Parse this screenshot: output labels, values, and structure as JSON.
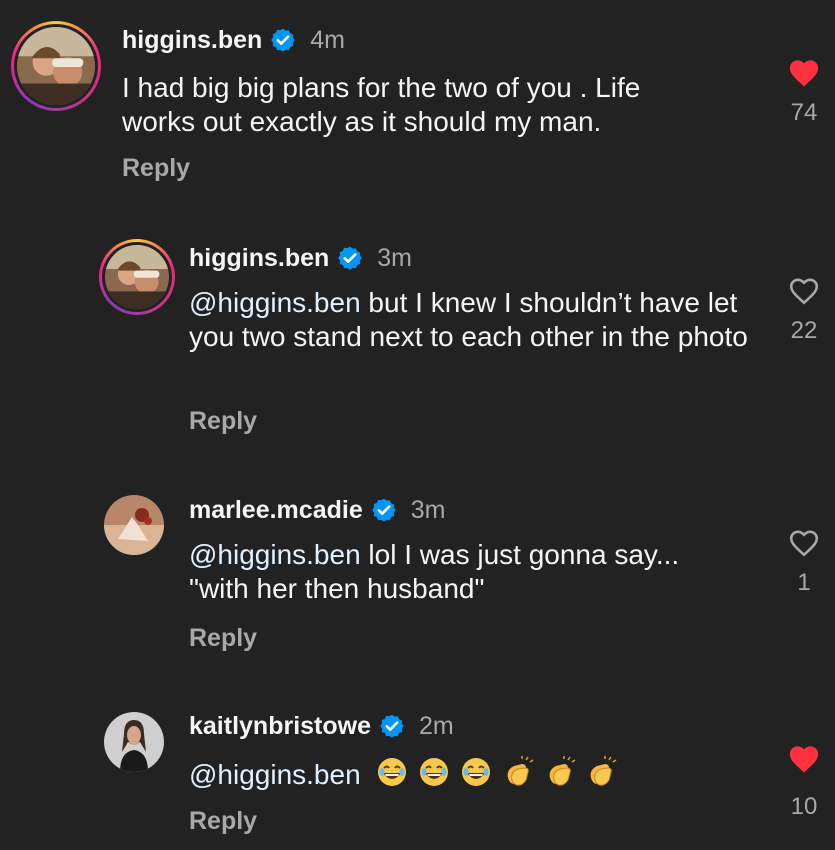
{
  "comments": [
    {
      "username": "higgins.ben",
      "time": "4m",
      "text": "I had big big plans for the two of you . Life works out exactly as it should my man.",
      "reply_label": "Reply",
      "likes": "74",
      "liked": true
    },
    {
      "username": "higgins.ben",
      "time": "3m",
      "mention": "@higgins.ben",
      "text": " but I knew I shouldn’t have let you two stand next to each other in the photo",
      "reply_label": "Reply",
      "likes": "22",
      "liked": false
    },
    {
      "username": "marlee.mcadie",
      "time": "3m",
      "mention": "@higgins.ben",
      "text": " lol I was just gonna say... \"with her then husband\"",
      "reply_label": "Reply",
      "likes": "1",
      "liked": false
    },
    {
      "username": "kaitlynbristowe",
      "time": "2m",
      "mention": "@higgins.ben",
      "text": "",
      "emojis": [
        "laughing-emoji",
        "laughing-emoji",
        "laughing-emoji",
        "clapping-emoji",
        "clapping-emoji",
        "clapping-emoji"
      ],
      "reply_label": "Reply",
      "likes": "10",
      "liked": true
    }
  ],
  "colors": {
    "background": "#222223",
    "text": "#f5f5f5",
    "secondary": "#a8a8a8",
    "mention": "#e0f1ff",
    "verified": "#0095f6",
    "liked": "#ff3040"
  }
}
